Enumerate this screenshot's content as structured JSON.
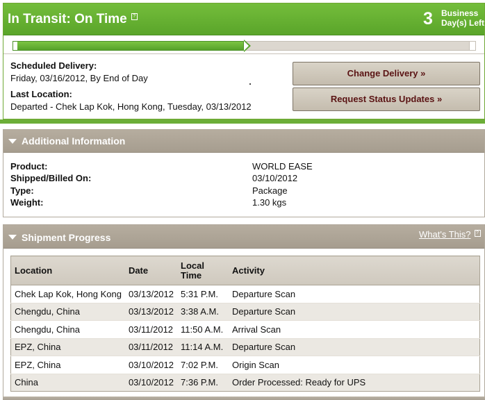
{
  "status": {
    "title": "In Transit: On Time",
    "help_glyph": "?",
    "days_number": "3",
    "days_label_line1": "Business",
    "days_label_line2": "Day(s) Left",
    "progress_fraction": 0.5,
    "scheduled_label": "Scheduled Delivery:",
    "scheduled_value": "Friday, 03/16/2012, By End of Day",
    "last_location_label": "Last Location:",
    "last_location_value": "Departed - Chek Lap Kok, Hong Kong, Tuesday, 03/13/2012",
    "change_button": "Change Delivery »",
    "request_button": "Request Status Updates »",
    "accent_color": "#6cae38"
  },
  "additional": {
    "title": "Additional Information",
    "rows": [
      {
        "label": "Product:",
        "value": "WORLD EASE"
      },
      {
        "label": "Shipped/Billed On:",
        "value": "03/10/2012"
      },
      {
        "label": "Type:",
        "value": "Package"
      },
      {
        "label": "Weight:",
        "value": "1.30 kgs"
      }
    ]
  },
  "shipment": {
    "title": "Shipment Progress",
    "whats_this": "What's This?",
    "headers": {
      "location": "Location",
      "date": "Date",
      "time": "Local Time",
      "activity": "Activity"
    },
    "rows": [
      {
        "location": "Chek Lap Kok, Hong Kong",
        "date": "03/13/2012",
        "time": "5:31 P.M.",
        "activity": "Departure Scan"
      },
      {
        "location": "Chengdu, China",
        "date": "03/13/2012",
        "time": "3:38 A.M.",
        "activity": "Departure Scan"
      },
      {
        "location": "Chengdu, China",
        "date": "03/11/2012",
        "time": "11:50 A.M.",
        "activity": "Arrival Scan"
      },
      {
        "location": "EPZ, China",
        "date": "03/11/2012",
        "time": "11:14 A.M.",
        "activity": "Departure Scan"
      },
      {
        "location": "EPZ, China",
        "date": "03/10/2012",
        "time": "7:02 P.M.",
        "activity": "Origin Scan"
      },
      {
        "location": "China",
        "date": "03/10/2012",
        "time": "7:36 P.M.",
        "activity": "Order Processed: Ready for UPS"
      }
    ]
  }
}
